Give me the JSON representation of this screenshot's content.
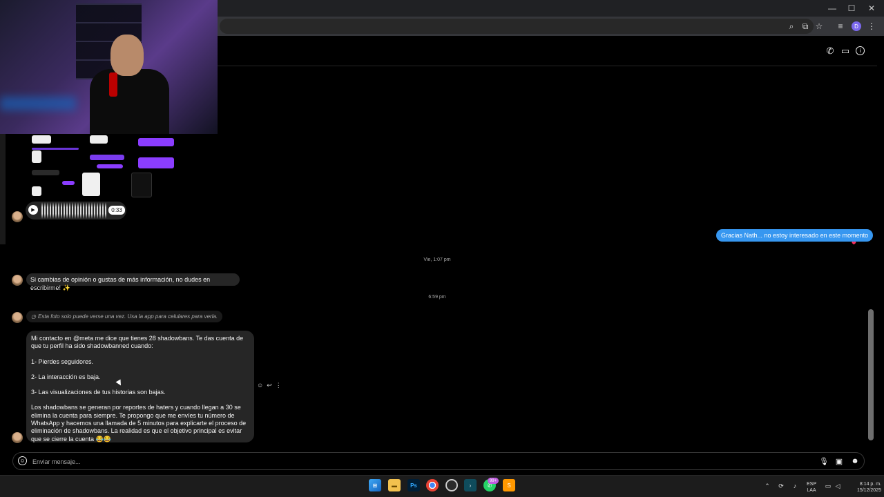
{
  "browser": {
    "window_controls": {
      "minimize": "—",
      "maximize": "☐",
      "close": "✕"
    },
    "toolbar_icons": [
      "zoom-icon",
      "cast-icon",
      "bookmark-star-icon",
      "media-icon"
    ],
    "profile_initial": "D"
  },
  "chat_header": {
    "icons": [
      "phone-icon",
      "video-call-icon",
      "info-icon"
    ]
  },
  "messages": {
    "voice_duration": "0:33",
    "outgoing_text": "Gracias Nath... no estoy interesado en este momento",
    "reaction": "❤",
    "timestamp_1": "Vie, 1:07 pm",
    "incoming_followup": "Si cambias de opinión o gustas de más información, no dudes en escribirme! ✨",
    "timestamp_2": "6:59 pm",
    "view_once_notice": "Esta foto solo puede verse una vez. Usa la app para celulares para verla.",
    "long_message": {
      "p1": "Mi contacto en @meta me dice que tienes 28 shadowbans. Te das cuenta de que tu perfil ha sido shadowbanned cuando:",
      "p2": "1- Pierdes seguidores.",
      "p3": "2- La interacción es baja.",
      "p4": "3- Las visualizaciones de tus historias son bajas.",
      "p5": "Los shadowbans se generan por reportes de haters y cuando llegan a 30 se elimina la cuenta para siempre. Te propongo que me envíes tu número de WhatsApp y hacemos una llamada de 5 minutos para explicarte el proceso de eliminación de shadowbans. La realidad es que el objetivo principal es evitar que se cierre la cuenta 😂😂"
    },
    "actions": {
      "react": "☺",
      "reply": "↩",
      "more": "⋮"
    }
  },
  "composer": {
    "placeholder": "Enviar mensaje...",
    "icons": [
      "microphone-icon",
      "image-icon",
      "sticker-icon"
    ]
  },
  "taskbar": {
    "apps": [
      "windows-start-icon",
      "file-explorer-icon",
      "photoshop-icon",
      "chrome-icon",
      "obs-icon",
      "terminal-icon",
      "whatsapp-icon",
      "sublime-icon"
    ],
    "photoshop_label": "Ps",
    "whatsapp_badge": "99+",
    "lang_top": "ESP",
    "lang_bottom": "LAA",
    "time": "8:14 p. m.",
    "date": "15/12/2025"
  },
  "colors": {
    "outgoing_bubble": "#3797f0",
    "incoming_bubble": "#262626",
    "background": "#000000"
  }
}
